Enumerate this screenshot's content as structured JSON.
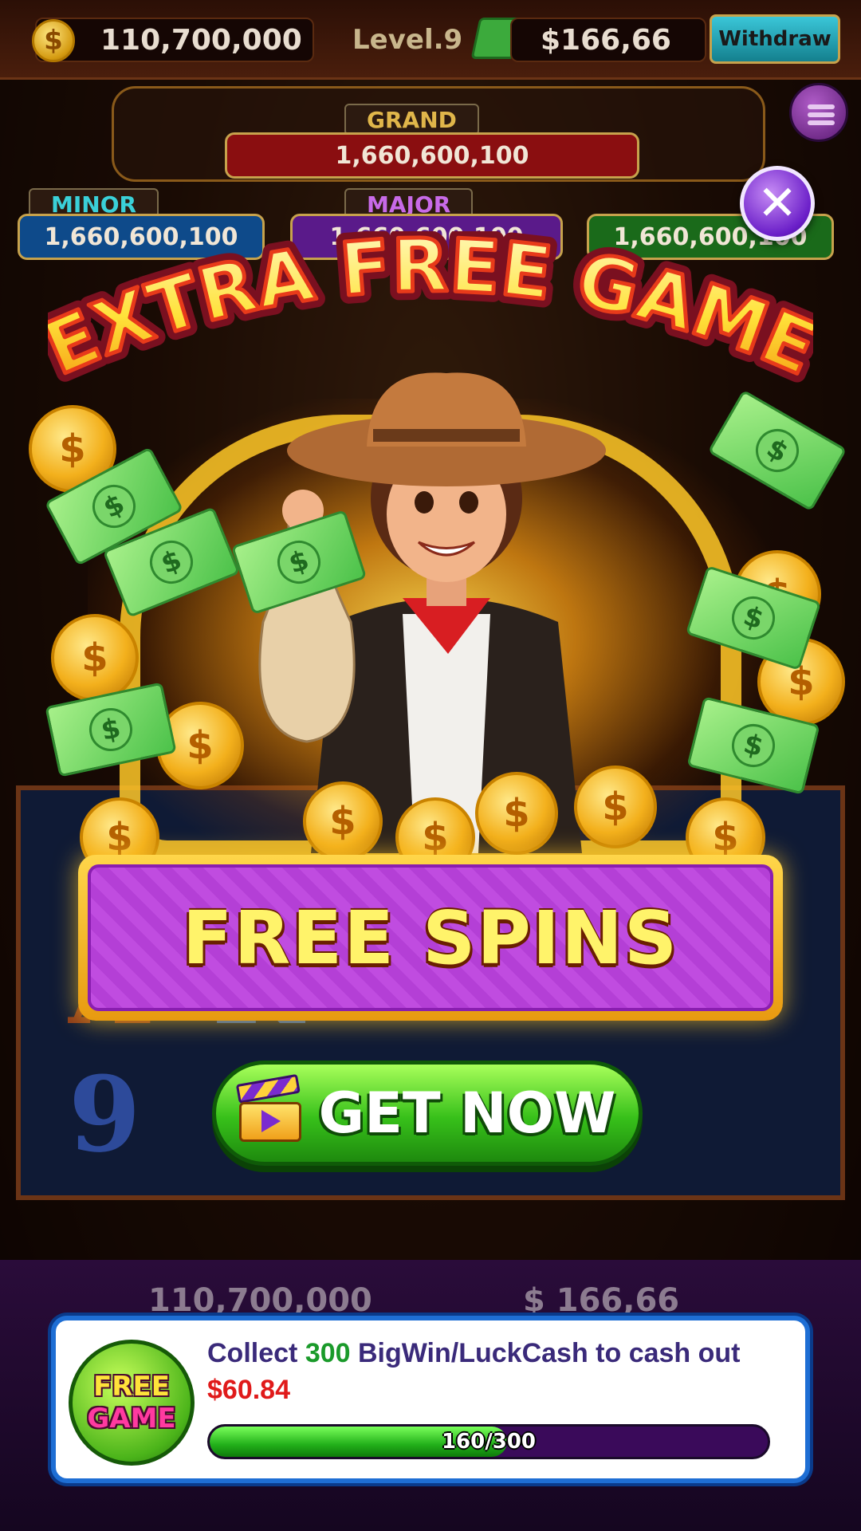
{
  "topbar": {
    "coin_icon": "coin-icon",
    "coin_balance": "110,700,000",
    "level": "Level.9",
    "cash_icon": "cash-stack-icon",
    "cash_balance": "$166,66",
    "withdraw_label": "Withdraw"
  },
  "jackpots": {
    "grand": {
      "label": "GRAND",
      "value": "1,660,600,100"
    },
    "minor": {
      "label": "MINOR",
      "value": "1,660,600,100"
    },
    "major": {
      "label": "MAJOR",
      "value": "1,660,600,100"
    },
    "mini": {
      "value": "1,660,600,100"
    }
  },
  "popup": {
    "title": "EXTRA FREE GAME",
    "reward_label": "FREE SPINS",
    "cta_label": "GET NOW",
    "cta_icon": "clapperboard-play-icon",
    "close_icon": "close-icon"
  },
  "bottombar": {
    "coin_balance": "110,700,000",
    "cash_balance": "$ 166,66"
  },
  "task_card": {
    "badge_line1": "FREE",
    "badge_line2": "GAME",
    "text_prefix": "Collect ",
    "amount": "300",
    "text_middle": " BigWin/LuckCash to cash out ",
    "cashout": "$60.84",
    "progress_label": "160/300",
    "progress_fraction": 0.5333
  },
  "colors": {
    "accent_green": "#37c01a",
    "accent_purple": "#c04ce0",
    "accent_gold": "#ffd64a",
    "cashout_red": "#e01a1a"
  }
}
